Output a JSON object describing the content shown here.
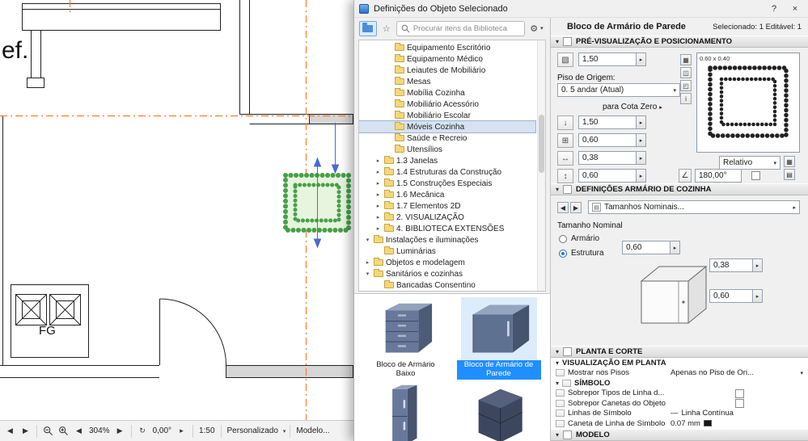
{
  "icons": {
    "chevron_down": "▾",
    "chevron_right": "▸",
    "tri_left": "◀",
    "tri_right": "▶",
    "star": "☆",
    "gear": "⚙",
    "help": "?",
    "close": "×",
    "pos": "▧",
    "cota": "↓",
    "grid": "⊞",
    "width": "↔",
    "height": "↕",
    "angle": "∠",
    "rotate": "↻",
    "sheet": "▤",
    "views": [
      "▦",
      "◫",
      "◰",
      "i"
    ],
    "mini_a": "▦",
    "mini_b": "▤"
  },
  "cad": {
    "plan_label_left": "ef.",
    "plan_label_fg": "FG",
    "statusbar": {
      "zoom": "304%",
      "rotation": "0,00°",
      "scale": "1:50",
      "preset": "Personalizado",
      "model": "Modelo..."
    }
  },
  "dialog": {
    "title": "Definições do Objeto Selecionado"
  },
  "browser": {
    "search_placeholder": "Procurar itens da Biblioteca",
    "tree": [
      {
        "label": "Equipamento Escritório",
        "indent": 2,
        "arrow": "",
        "selected": false
      },
      {
        "label": "Equipamento Médico",
        "indent": 2,
        "arrow": "",
        "selected": false
      },
      {
        "label": "Leiautes de Mobiliário",
        "indent": 2,
        "arrow": "",
        "selected": false
      },
      {
        "label": "Mesas",
        "indent": 2,
        "arrow": "",
        "selected": false
      },
      {
        "label": "Mobília Cozinha",
        "indent": 2,
        "arrow": "",
        "selected": false
      },
      {
        "label": "Mobiliário Acessório",
        "indent": 2,
        "arrow": "",
        "selected": false
      },
      {
        "label": "Mobiliário Escolar",
        "indent": 2,
        "arrow": "",
        "selected": false
      },
      {
        "label": "Móveis Cozinha",
        "indent": 2,
        "arrow": "",
        "selected": true
      },
      {
        "label": "Saúde e Recreio",
        "indent": 2,
        "arrow": "",
        "selected": false
      },
      {
        "label": "Utensílios",
        "indent": 2,
        "arrow": "",
        "selected": false
      },
      {
        "label": "1.3 Janelas",
        "indent": 1,
        "arrow": "collapsed",
        "selected": false
      },
      {
        "label": "1.4 Estruturas da Construção",
        "indent": 1,
        "arrow": "collapsed",
        "selected": false
      },
      {
        "label": "1.5 Construções Especiais",
        "indent": 1,
        "arrow": "collapsed",
        "selected": false
      },
      {
        "label": "1.6 Mecânica",
        "indent": 1,
        "arrow": "collapsed",
        "selected": false
      },
      {
        "label": "1.7 Elementos 2D",
        "indent": 1,
        "arrow": "collapsed",
        "selected": false
      },
      {
        "label": "2. VISUALIZAÇÃO",
        "indent": 1,
        "arrow": "collapsed",
        "selected": false
      },
      {
        "label": "4. BIBLIOTECA EXTENSÕES",
        "indent": 1,
        "arrow": "collapsed",
        "selected": false
      },
      {
        "label": "Instalações e iluminações",
        "indent": 0,
        "arrow": "expanded",
        "selected": false
      },
      {
        "label": "Luminárias",
        "indent": 1,
        "arrow": "",
        "selected": false
      },
      {
        "label": "Objetos e modelagem",
        "indent": 0,
        "arrow": "collapsed",
        "selected": false
      },
      {
        "label": "Sanitários e cozinhas",
        "indent": 0,
        "arrow": "expanded",
        "selected": false
      },
      {
        "label": "Bancadas Consentino",
        "indent": 1,
        "arrow": "",
        "selected": false
      }
    ],
    "thumbnails": [
      {
        "label": "Bloco de Armário Baixo",
        "selected": false,
        "kind": "base"
      },
      {
        "label": "Bloco de Armário de Parede",
        "selected": true,
        "kind": "wall"
      },
      {
        "label": "",
        "selected": false,
        "kind": "tall"
      },
      {
        "label": "",
        "selected": false,
        "kind": "corner"
      }
    ]
  },
  "settings": {
    "object_name": "Bloco de Armário de Parede",
    "selection_status": "Selecionado: 1 Editável: 1",
    "pre": {
      "title": "PRÉ-VISUALIZAÇÃO E POSICIONAMENTO",
      "field_top": "1,50",
      "piso_label": "Piso de Origem:",
      "piso_value": "0. 5 andar (Atual)",
      "cota_label": "para Cota Zero",
      "cota_value": "1,50",
      "dim_a": "0,60",
      "dim_b": "0,38",
      "dim_c": "0,60",
      "preview_caption": "0.60 x 0.40",
      "relative": "Relativo",
      "angle": "180,00°"
    },
    "def": {
      "title": "DEFINIÇÕES ARMÁRIO DE COZINHA",
      "sizes_dropdown": "Tamanhos Nominais...",
      "nominal_label": "Tamanho Nominal",
      "radio_armario": "Armário",
      "radio_estrutura": "Estrutura",
      "dim_top": "0,60",
      "dim_depth": "0,38",
      "dim_height": "0,60"
    },
    "plan": {
      "title": "PLANTA E CORTE",
      "sub_view": "VISUALIZAÇÃO EM PLANTA",
      "sub_symbol": "SÍMBOLO",
      "rows_view": [
        {
          "label": "Mostrar nos Pisos",
          "value": "Apenas no Piso de Ori...",
          "control": "dropdown"
        }
      ],
      "rows_symbol": [
        {
          "label": "Sobrepor Tipos de Linha d...",
          "value": "",
          "control": "checkbox"
        },
        {
          "label": "Sobrepor Canetas do Objeto",
          "value": "",
          "control": "checkbox"
        },
        {
          "label": "Linhas de Símbolo",
          "value": "Linha Contínua",
          "control": "line"
        },
        {
          "label": "Caneta de Linha de Símbolo",
          "value": "0.07 mm",
          "control": "pen"
        }
      ]
    },
    "model": {
      "title": "MODELO"
    }
  }
}
